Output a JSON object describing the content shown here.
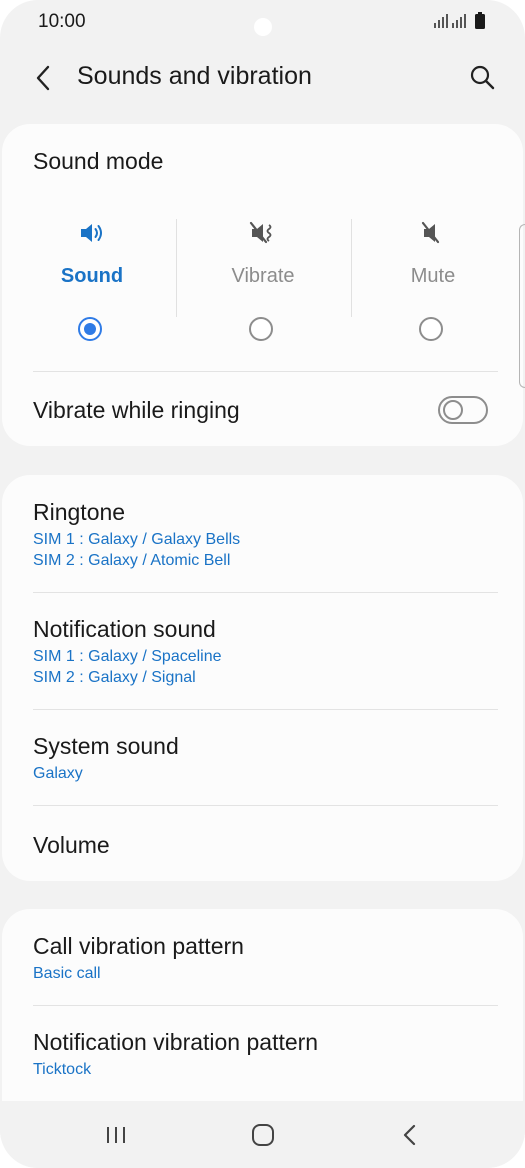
{
  "status_bar": {
    "time": "10:00"
  },
  "app_bar": {
    "title": "Sounds and vibration"
  },
  "sound_mode": {
    "title": "Sound mode",
    "modes": [
      {
        "label": "Sound",
        "icon": "speaker-icon",
        "selected": true
      },
      {
        "label": "Vibrate",
        "icon": "vibrate-icon",
        "selected": false
      },
      {
        "label": "Mute",
        "icon": "mute-icon",
        "selected": false
      }
    ],
    "vibrate_while_ringing": {
      "label": "Vibrate while ringing",
      "enabled": false
    }
  },
  "sounds": [
    {
      "title": "Ringtone",
      "subtitle_lines": [
        "SIM 1 : Galaxy / Galaxy Bells",
        "SIM 2 : Galaxy / Atomic Bell"
      ]
    },
    {
      "title": "Notification sound",
      "subtitle_lines": [
        "SIM 1 : Galaxy / Spaceline",
        "SIM 2 : Galaxy / Signal"
      ]
    },
    {
      "title": "System sound",
      "subtitle_lines": [
        "Galaxy"
      ]
    },
    {
      "title": "Volume",
      "subtitle_lines": []
    }
  ],
  "vibration": [
    {
      "title": "Call vibration pattern",
      "subtitle_lines": [
        "Basic call"
      ]
    },
    {
      "title": "Notification vibration pattern",
      "subtitle_lines": [
        "Ticktock"
      ]
    }
  ],
  "colors": {
    "accent": "#1a73c6",
    "radio": "#2f7be6",
    "background": "#f2f2f2",
    "card": "#fcfcfc"
  }
}
